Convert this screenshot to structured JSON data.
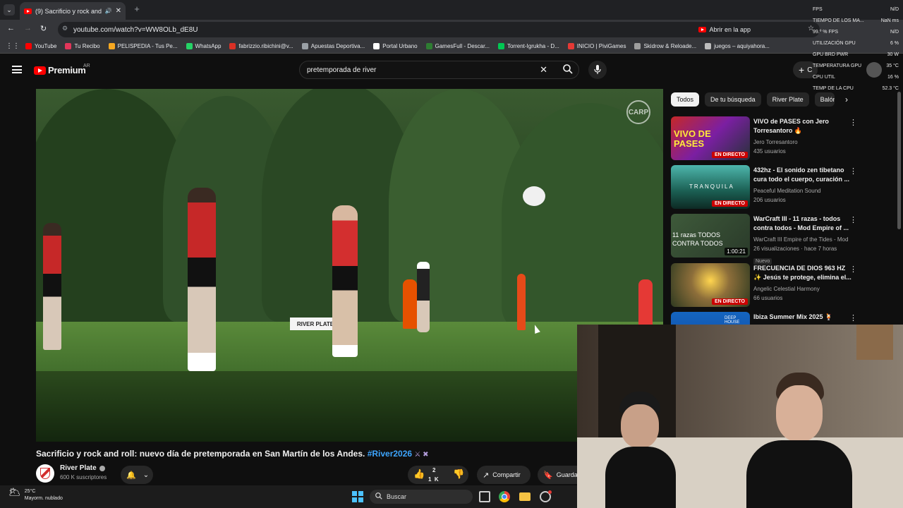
{
  "browser": {
    "tab_title": "(9) Sacrificio y rock and r",
    "url": "youtube.com/watch?v=WW8OLb_dE8U",
    "open_in_app": "Abrir en la app",
    "bookmarks": [
      {
        "label": "YouTube",
        "color": "#ff0000"
      },
      {
        "label": "Tu Recibo",
        "color": "#e2365a"
      },
      {
        "label": "PELISPEDIA - Tus Pe...",
        "color": "#f6a821"
      },
      {
        "label": "WhatsApp",
        "color": "#25d366"
      },
      {
        "label": "fabrizzio.ribichini@v...",
        "color": "#d93025"
      },
      {
        "label": "Apuestas Deportiva...",
        "color": "#9aa0a6"
      },
      {
        "label": "Portal Urbano",
        "color": "#ffffff"
      },
      {
        "label": "GamesFull - Descar...",
        "color": "#2e7d32"
      },
      {
        "label": "Torrent-Igrukha - D...",
        "color": "#00c853"
      },
      {
        "label": "INICIO | PiviGames",
        "color": "#e53935"
      },
      {
        "label": "Skidrow & Reloade...",
        "color": "#9e9e9e"
      },
      {
        "label": "juegos – aquiyahora...",
        "color": "#bdbdbd"
      }
    ]
  },
  "youtube": {
    "logo_text": "Premium",
    "country": "AR",
    "search_query": "pretemporada de river",
    "create_label": "C"
  },
  "chips": [
    "Todos",
    "De tu búsqueda",
    "River Plate",
    "Balón"
  ],
  "related": [
    {
      "title": "VIVO de PASES con Jero Torresantoro 🔥",
      "channel": "Jero Torresantoro",
      "views": "435 usuarios",
      "badge": "EN DIRECTO",
      "badge_type": "live",
      "thumb_text": "VIVO DE PASES"
    },
    {
      "title": "432hz - El sonido zen tibetano cura todo el cuerpo, curación ...",
      "channel": "Peaceful Meditation Sound",
      "views": "206 usuarios",
      "badge": "EN DIRECTO",
      "badge_type": "live",
      "thumb_text": "TRANQUILA"
    },
    {
      "title": "WarCraft III - 11 razas - todos contra todos - Mod Empire of ...",
      "channel": "WarCraft III Empire of the Tides - Mod",
      "views": "26 visualizaciones · hace 7 horas",
      "badge": "1:00:21",
      "badge_type": "duration",
      "thumb_text": "11 razas TODOS CONTRA TODOS",
      "new": "Nuevo"
    },
    {
      "title": "FRECUENCIA DE DIOS 963 HZ ✨ Jesús te protege, elimina el...",
      "channel": "Angelic Celestial Harmony",
      "views": "66 usuarios",
      "badge": "EN DIRECTO",
      "badge_type": "live",
      "thumb_text": ""
    },
    {
      "title": "Ibiza Summer Mix 2025 🍹",
      "channel": "",
      "views": "",
      "badge": "",
      "badge_type": "none",
      "thumb_text": "DEEP HOUSE"
    }
  ],
  "video": {
    "title": "Sacrificio y rock and roll: nuevo día de pretemporada en San Martín de los Andes.",
    "hashtag": "#River2026",
    "channel_name": "River Plate",
    "subscribers": "600 K suscriptores",
    "likes_top": "2",
    "likes_bottom": "1  K",
    "share_label": "Compartir",
    "save_label": "Guarda",
    "field_sign": "RIVER PLATE"
  },
  "overlay": {
    "rows": [
      {
        "label": "FPS",
        "value": "N/D"
      },
      {
        "label": "TIEMPO DE LOS MA...",
        "value": "NaN ms"
      },
      {
        "label": "99.º % FPS",
        "value": "N/D"
      },
      {
        "label": "UTILIZACIÓN GPU",
        "value": "6 %"
      },
      {
        "label": "GPU BRD PWR",
        "value": "30 W"
      },
      {
        "label": "TEMPERATURA GPU",
        "value": "35 °C"
      },
      {
        "label": "CPU UTIL",
        "value": "16 %"
      },
      {
        "label": "TEMP DE LA CPU",
        "value": "52.3 °C"
      }
    ]
  },
  "taskbar": {
    "temp": "25°C",
    "condition": "Mayorm. nublado",
    "search_label": "Buscar"
  },
  "colors": {
    "yt_red": "#ff0000",
    "link_blue": "#3ea6ff",
    "live_red": "#cc0000"
  }
}
